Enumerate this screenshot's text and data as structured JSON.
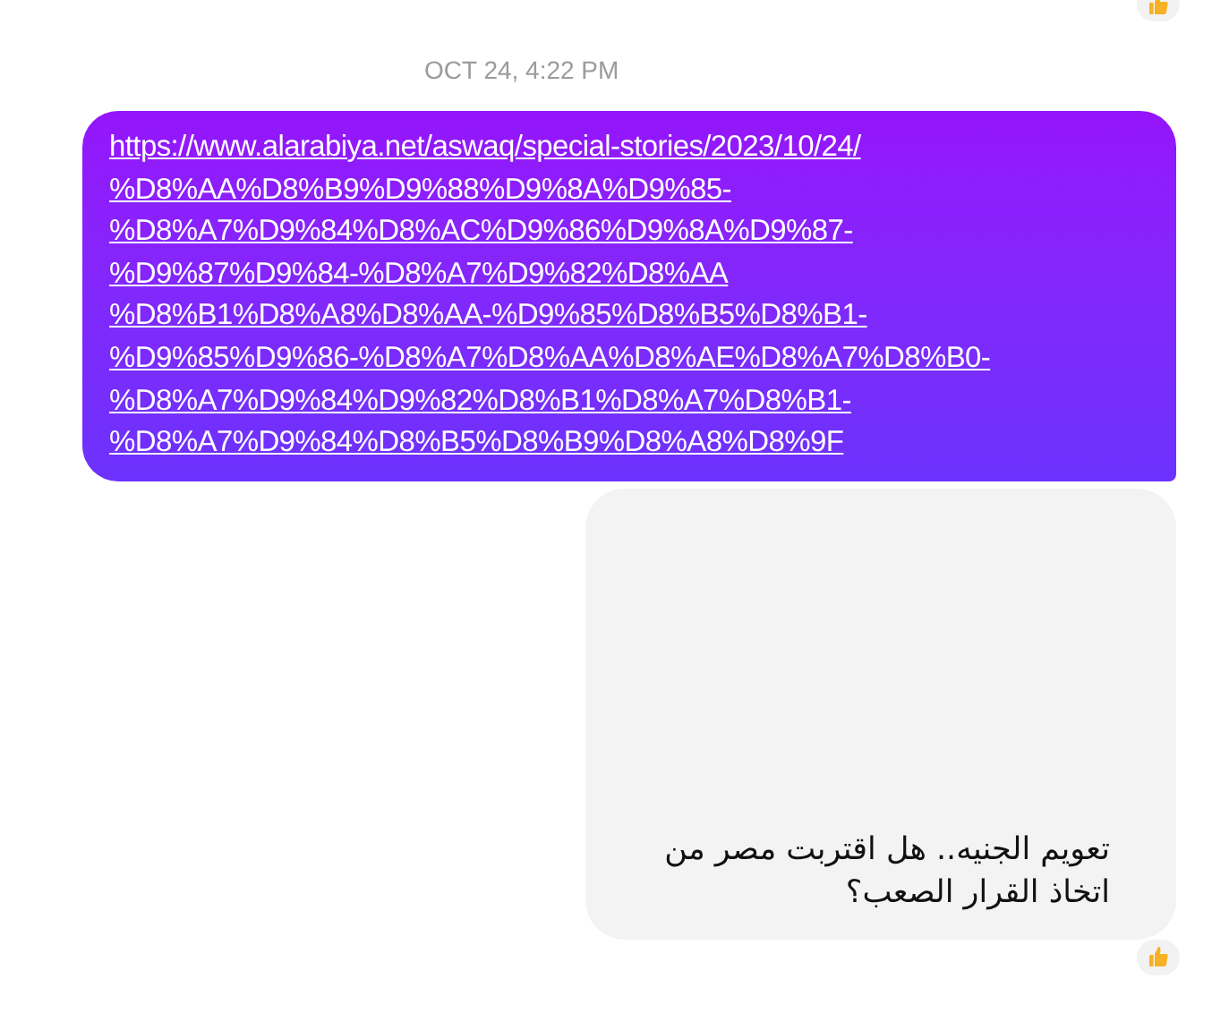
{
  "earlier_reaction": {
    "reacted": true
  },
  "timestamp": "OCT 24, 4:22 PM",
  "messages": [
    {
      "kind": "link",
      "url_lines": [
        "https://www.alarabiya.net/aswaq/special-stories/2023/10/24/",
        "%D8%AA%D8%B9%D9%88%D9%8A%D9%85-",
        "%D8%A7%D9%84%D8%AC%D9%86%D9%8A%D9%87-",
        "%D9%87%D9%84-%D8%A7%D9%82%D8%AA",
        "%D8%B1%D8%A8%D8%AA-%D9%85%D8%B5%D8%B1-",
        "%D9%85%D9%86-%D8%A7%D8%AA%D8%AE%D8%A7%D8%B0-",
        "%D8%A7%D9%84%D9%82%D8%B1%D8%A7%D8%B1-",
        "%D8%A7%D9%84%D8%B5%D8%B9%D8%A8%D8%9F"
      ],
      "reacted": false
    },
    {
      "kind": "preview",
      "title": "تعويم الجنيه.. هل اقتربت مصر من اتخاذ القرار الصعب؟",
      "reacted": true
    }
  ]
}
